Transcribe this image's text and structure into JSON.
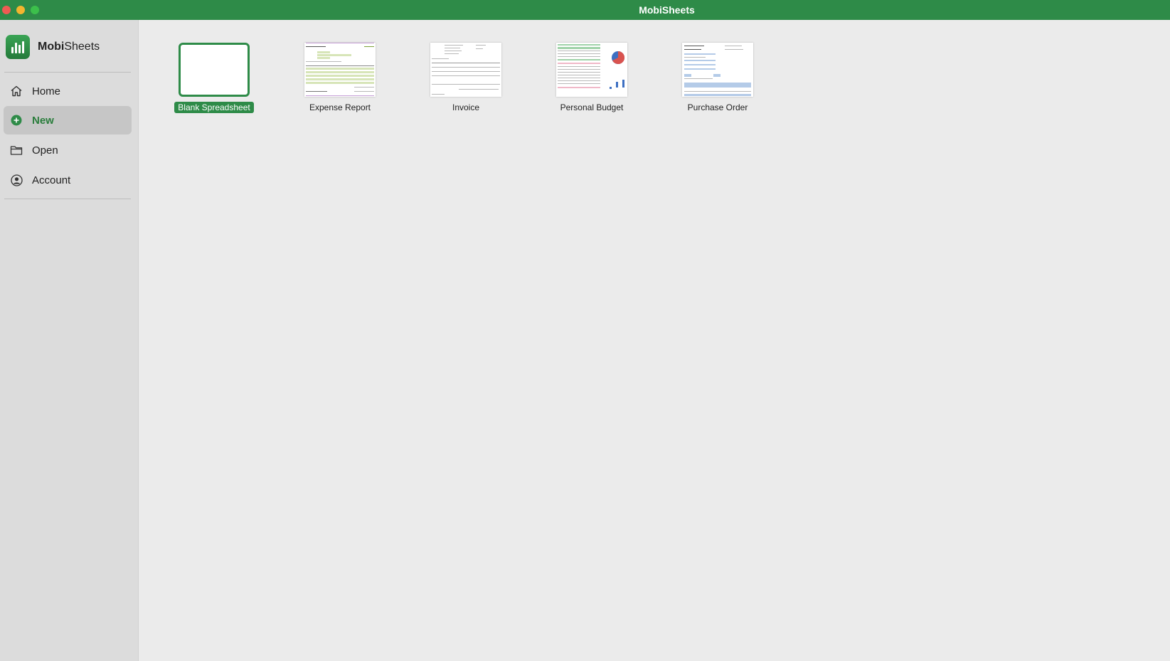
{
  "window": {
    "title": "MobiSheets"
  },
  "brand": {
    "name_bold": "Mobi",
    "name_rest": "Sheets"
  },
  "sidebar": {
    "items": [
      {
        "label": "Home",
        "icon": "home-icon",
        "active": false
      },
      {
        "label": "New",
        "icon": "plus-circle-icon",
        "active": true
      },
      {
        "label": "Open",
        "icon": "folder-icon",
        "active": false
      },
      {
        "label": "Account",
        "icon": "user-circle-icon",
        "active": false
      }
    ]
  },
  "templates": [
    {
      "label": "Blank Spreadsheet",
      "selected": true
    },
    {
      "label": "Expense Report",
      "selected": false
    },
    {
      "label": "Invoice",
      "selected": false
    },
    {
      "label": "Personal Budget",
      "selected": false
    },
    {
      "label": "Purchase Order",
      "selected": false
    }
  ],
  "colors": {
    "accent": "#2e8b48",
    "sidebar": "#dcdcdc",
    "main": "#ebebeb"
  }
}
